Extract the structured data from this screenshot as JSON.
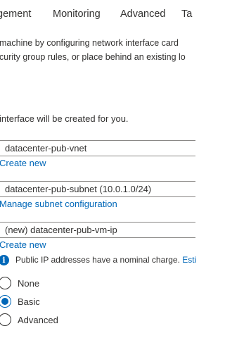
{
  "tabs": [
    "gement",
    "Monitoring",
    "Advanced",
    "Ta"
  ],
  "description": {
    "line1": "machine by configuring network interface card",
    "line2": "curity group rules, or place behind an existing lo"
  },
  "nic_note": "interface will be created for you.",
  "virtual_network": {
    "value": "datacenter-pub-vnet",
    "create_link": "Create new"
  },
  "subnet": {
    "value": "datacenter-pub-subnet (10.0.1.0/24)",
    "manage_link": "Manage subnet configuration"
  },
  "public_ip": {
    "value": "(new) datacenter-pub-vm-ip",
    "create_link": "Create new",
    "info_text": "Public IP addresses have a nominal charge.",
    "info_link": "Esti"
  },
  "nic_security_group": {
    "options": [
      "None",
      "Basic",
      "Advanced"
    ],
    "selected": "Basic"
  },
  "colors": {
    "accent": "#0067b8",
    "text": "#323130",
    "border": "#8a8886"
  }
}
